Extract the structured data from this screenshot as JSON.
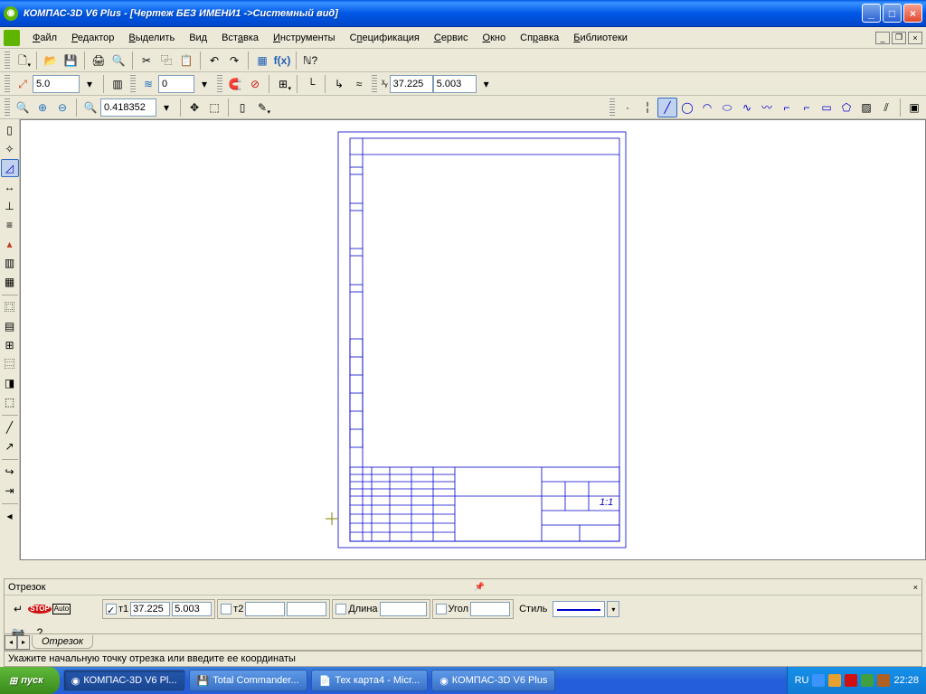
{
  "title": "КОМПАС-3D V6 Plus - [Чертеж БЕЗ ИМЕНИ1 ->Системный вид]",
  "menu": {
    "file": "Файл",
    "editor": "Редактор",
    "select": "Выделить",
    "view": "Вид",
    "insert": "Вставка",
    "tools": "Инструменты",
    "spec": "Спецификация",
    "service": "Сервис",
    "window": "Окно",
    "help": "Справка",
    "libs": "Библиотеки"
  },
  "tb2": {
    "step": "5.0",
    "layer": "0"
  },
  "coord": {
    "x_lbl": "X",
    "x": "37.225",
    "y": "5.003"
  },
  "zoom": "0.418352",
  "panel": {
    "title": "Отрезок",
    "t1_lbl": "т1",
    "t1x": "37.225",
    "t1y": "5.003",
    "t2_lbl": "т2",
    "len_lbl": "Длина",
    "ang_lbl": "Угол",
    "style_lbl": "Стиль",
    "tab": "Отрезок"
  },
  "status": "Укажите начальную точку отрезка или введите ее координаты",
  "task": {
    "start": "пуск",
    "btns": [
      "КОМПАС-3D V6 Pl...",
      "Total Commander...",
      "Тех карта4 - Micr...",
      "КОМПАС-3D V6 Plus"
    ],
    "lang": "RU",
    "time": "22:28"
  }
}
